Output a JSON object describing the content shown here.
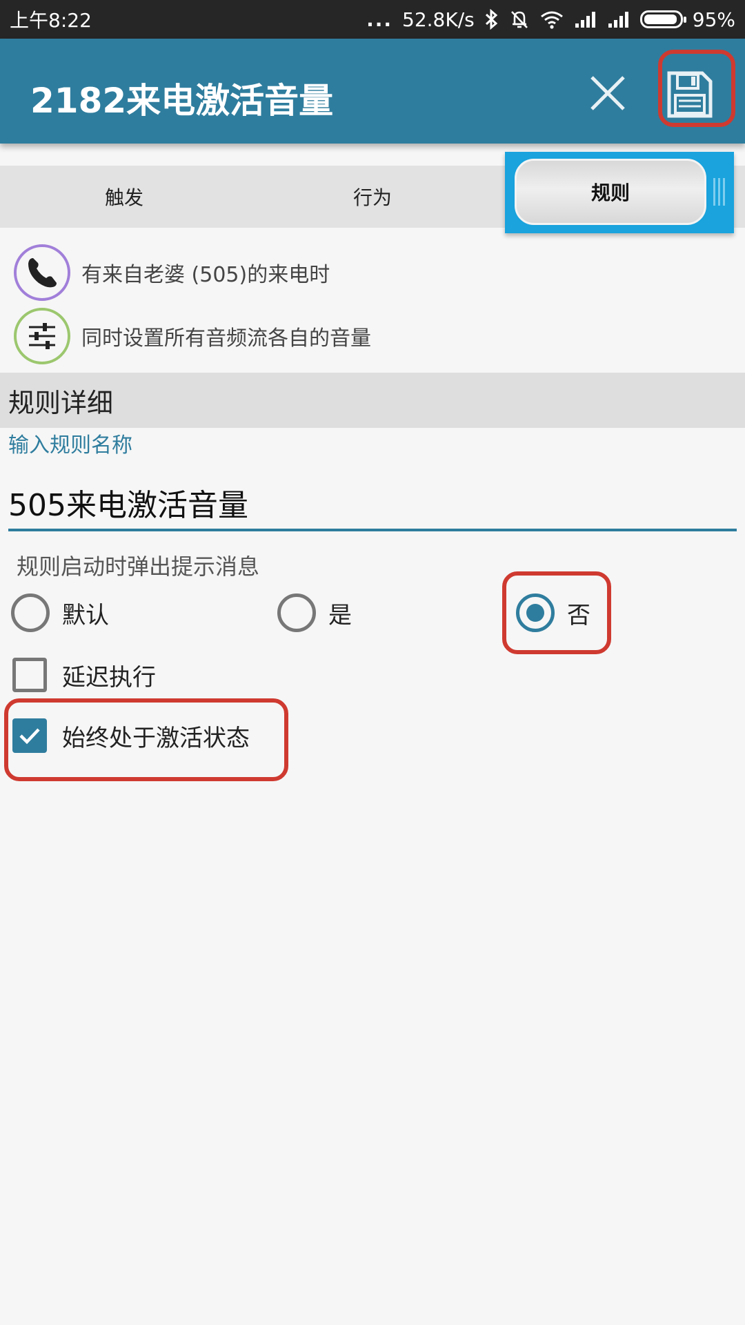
{
  "status_bar": {
    "time": "上午8:22",
    "more": "...",
    "speed": "52.8K/s",
    "battery": "95%",
    "icons": [
      "bluetooth-icon",
      "bell-muted-icon",
      "wifi-icon",
      "signal-icon",
      "signal-icon",
      "battery-icon"
    ]
  },
  "app_bar": {
    "title": "2182来电激活音量",
    "actions": [
      "close-icon",
      "save-icon"
    ],
    "highlight_color": "#cf3a30",
    "color": "#2f7d9e"
  },
  "tabs": {
    "items": [
      {
        "label": "触发",
        "active": false
      },
      {
        "label": "行为",
        "active": false
      },
      {
        "label": "规则",
        "active": true
      }
    ],
    "active_color": "#1aa3dd"
  },
  "summary": [
    {
      "icon": "phone-icon",
      "text": "有来自老婆 (505)的来电时",
      "ring_color": "#a17fd9"
    },
    {
      "icon": "sliders-icon",
      "text": "同时设置所有音频流各自的音量",
      "ring_color": "#9cc76e"
    }
  ],
  "rule_detail": {
    "header": "规则详细",
    "name_label": "输入规则名称",
    "name_value": "505来电激活音量",
    "popup_label": "规则启动时弹出提示消息",
    "popup_options": [
      {
        "label": "默认",
        "checked": false
      },
      {
        "label": "是",
        "checked": false
      },
      {
        "label": "否",
        "checked": true
      }
    ],
    "delay": {
      "label": "延迟执行",
      "checked": false
    },
    "always_active": {
      "label": "始终处于激活状态",
      "checked": true
    }
  }
}
